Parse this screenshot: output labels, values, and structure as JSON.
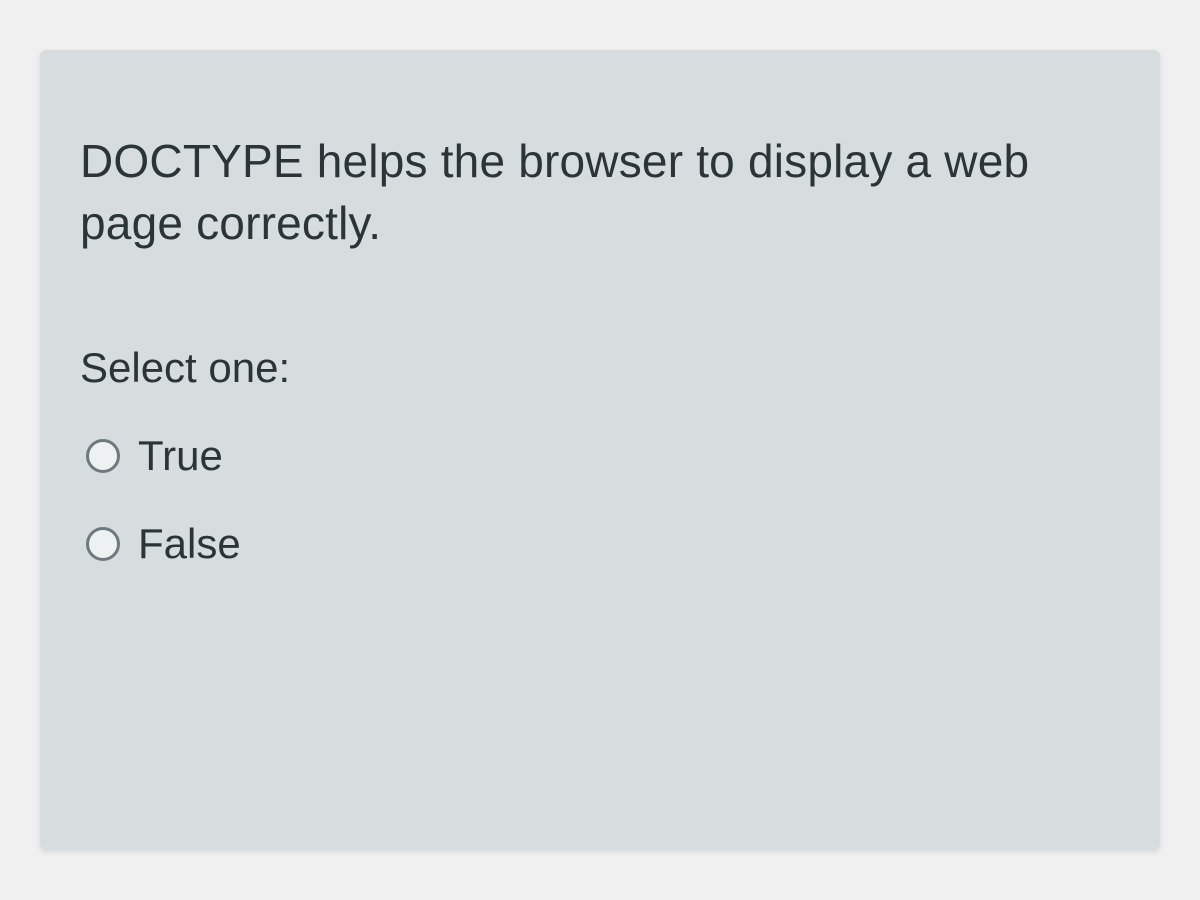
{
  "question": {
    "text": "DOCTYPE helps the browser to display a web page correctly.",
    "prompt": "Select one:",
    "options": [
      {
        "label": "True"
      },
      {
        "label": "False"
      }
    ]
  }
}
